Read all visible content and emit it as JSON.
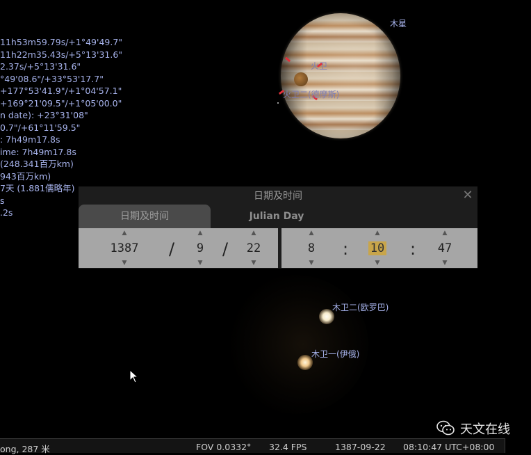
{
  "info_lines": [
    "  11h53m59.79s/+1°49'49.7\"",
    "  11h22m35.43s/+5°13'31.6\"",
    "2.37s/+5°13'31.6\"",
    "°49'08.6\"/+33°53'17.7\"",
    "  +177°53'41.9\"/+1°04'57.1\"",
    "  +169°21'09.5\"/+1°05'00.0\"",
    "n date): +23°31'08\"",
    "0.7\"/+61°11'59.5\"",
    ": 7h49m17.8s",
    "ime: 7h49m17.8s",
    " (248.341百万km)",
    "943百万km)",
    "",
    "7天 (1.881儒略年)",
    "s",
    ".2s",
    "",
    "",
    ""
  ],
  "sky_labels": {
    "jupiter": "木星",
    "io_partial_top": "火卫",
    "io_near": "火卫二(德摩斯)",
    "europa": "木卫二(欧罗巴)",
    "io": "木卫一(伊俄)"
  },
  "dialog": {
    "title": "日期及时间",
    "close": "✕",
    "tab_date": "日期及时间",
    "tab_jd": "Julian Day",
    "spin_up": "▲",
    "spin_down": "▼",
    "year": "1387",
    "month": "9",
    "day": "22",
    "hour": "8",
    "minute": "10",
    "second": "47",
    "date_sep": "/",
    "time_sep": ":"
  },
  "watermark": {
    "text": "天文在线"
  },
  "status": {
    "location": "ong, 287 米",
    "fov": "FOV 0.0332°",
    "fps": "32.4 FPS",
    "date": "1387-09-22",
    "time": "08:10:47 UTC+08:00"
  },
  "colors": {
    "label": "#a7b3ec",
    "highlight": "#c8a54a",
    "dialog_field": "#a6a6a6"
  }
}
